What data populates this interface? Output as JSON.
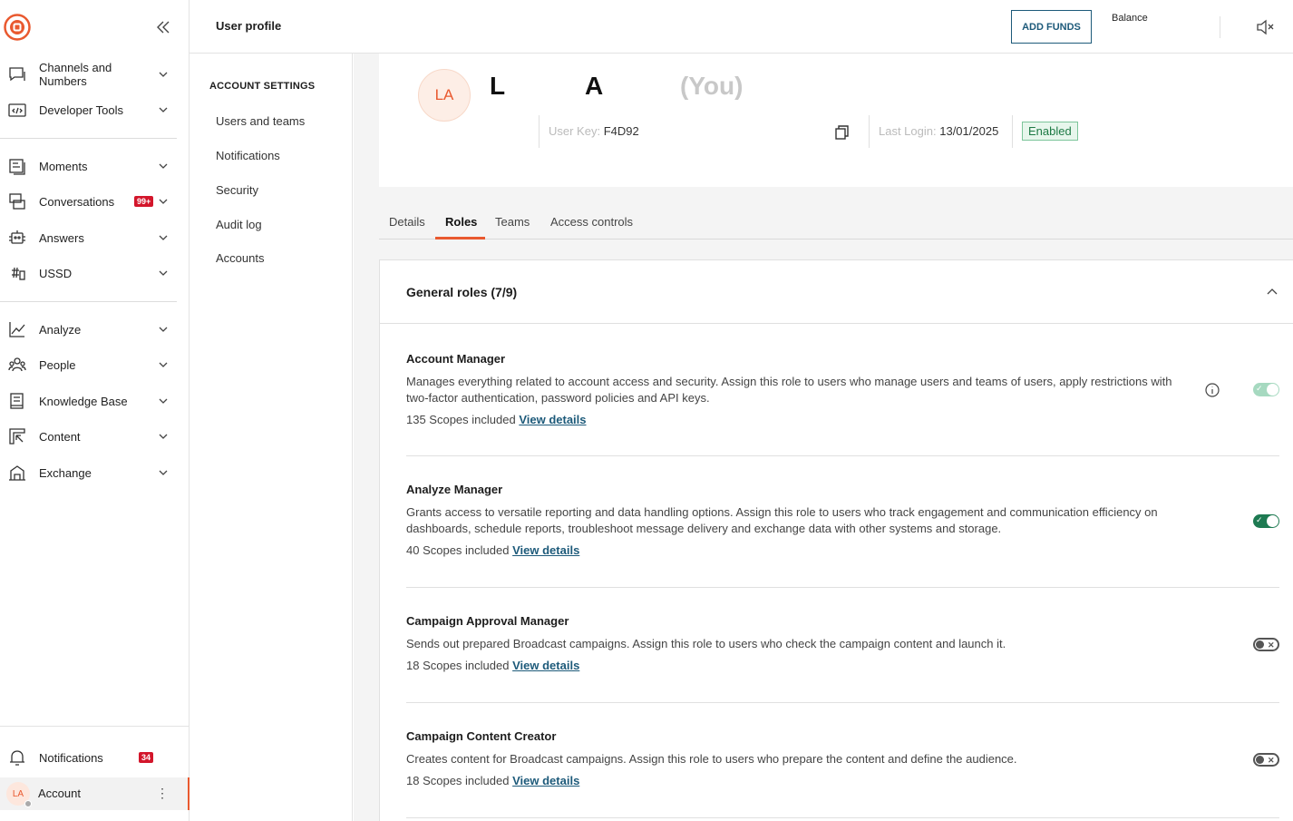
{
  "nav": {
    "items": [
      {
        "label": "Channels and Numbers",
        "icon": "chat-icon"
      },
      {
        "label": "Developer Tools",
        "icon": "code-icon"
      },
      {
        "label": "Moments",
        "icon": "moments-icon"
      },
      {
        "label": "Conversations",
        "icon": "conversations-icon",
        "badge": "99+"
      },
      {
        "label": "Answers",
        "icon": "bot-icon"
      },
      {
        "label": "USSD",
        "icon": "ussd-icon"
      },
      {
        "label": "Analyze",
        "icon": "analyze-icon"
      },
      {
        "label": "People",
        "icon": "people-icon"
      },
      {
        "label": "Knowledge Base",
        "icon": "book-icon"
      },
      {
        "label": "Content",
        "icon": "content-icon"
      },
      {
        "label": "Exchange",
        "icon": "exchange-icon"
      }
    ],
    "notifications": {
      "label": "Notifications",
      "badge": "34"
    },
    "account": {
      "label": "Account",
      "initials": "LA"
    }
  },
  "header": {
    "title": "User profile",
    "add_funds": "ADD FUNDS",
    "balance_label": "Balance"
  },
  "settings": {
    "title": "ACCOUNT SETTINGS",
    "items": [
      "Users and teams",
      "Notifications",
      "Security",
      "Audit log",
      "Accounts"
    ]
  },
  "profile": {
    "initials": "LA",
    "first_name": "L",
    "last_name": "A",
    "you_label": "(You)",
    "user_key_label": "User Key:",
    "user_key": "F4D92",
    "last_login_label": "Last Login:",
    "last_login": "13/01/2025",
    "status": "Enabled"
  },
  "tabs": [
    {
      "label": "Details",
      "active": false
    },
    {
      "label": "Roles",
      "active": true
    },
    {
      "label": "Teams",
      "active": false
    },
    {
      "label": "Access controls",
      "active": false
    }
  ],
  "roles_section": {
    "title": "General roles (7/9)",
    "roles": [
      {
        "name": "Account Manager",
        "description": "Manages everything related to account access and security. Assign this role to users who manage users and teams of users, apply restrictions with two-factor authentication, password policies and API keys.",
        "scopes": "135 Scopes included",
        "link": "View details",
        "toggle": "on-disabled"
      },
      {
        "name": "Analyze Manager",
        "description": "Grants access to versatile reporting and data handling options. Assign this role to users who track engagement and communication efficiency on dashboards, schedule reports, troubleshoot message delivery and exchange data with other systems and storage.",
        "scopes": "40 Scopes included",
        "link": "View details",
        "toggle": "on"
      },
      {
        "name": "Campaign Approval Manager",
        "description": "Sends out prepared Broadcast campaigns. Assign this role to users who check the campaign content and launch it.",
        "scopes": "18 Scopes included",
        "link": "View details",
        "toggle": "off"
      },
      {
        "name": "Campaign Content Creator",
        "description": "Creates content for Broadcast campaigns. Assign this role to users who prepare the content and define the audience.",
        "scopes": "18 Scopes included",
        "link": "View details",
        "toggle": "off"
      }
    ]
  },
  "colors": {
    "accent": "#e9592f",
    "link": "#1d5a7a",
    "toggle_on": "#1e7a52",
    "badge": "#d3162b"
  }
}
